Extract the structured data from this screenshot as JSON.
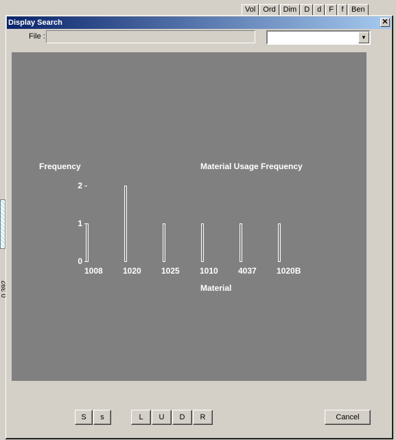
{
  "background": {
    "toolbar_tabs": [
      "Vol",
      "Ord",
      "Dim",
      "D",
      "d",
      "F",
      "f",
      "Ben"
    ],
    "side_label": "0.392"
  },
  "dialog": {
    "title": "Display Search",
    "close_label": "✕",
    "file_label": "File :",
    "file_value": "",
    "select_value": ""
  },
  "chart_data": {
    "type": "bar",
    "title": "Material Usage Frequency",
    "ylabel": "Frequency",
    "xlabel": "Material",
    "categories": [
      "1008",
      "1020",
      "1025",
      "1010",
      "4037",
      "1020B"
    ],
    "values": [
      1,
      2,
      1,
      1,
      1,
      1
    ],
    "ylim": [
      0,
      2
    ],
    "yticks": [
      "0",
      "1",
      "2"
    ],
    "grid": false,
    "colors": {
      "background": "#808080",
      "bar": "#ffffff",
      "text": "#ffffff"
    }
  },
  "buttons": {
    "S": "S",
    "s": "s",
    "L": "L",
    "U": "U",
    "D": "D",
    "R": "R",
    "cancel": "Cancel"
  }
}
